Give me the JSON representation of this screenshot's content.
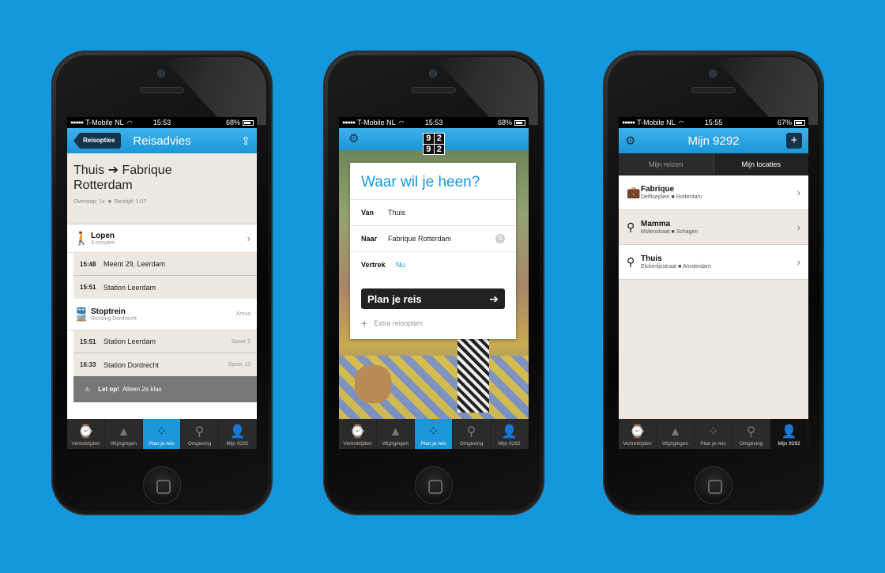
{
  "statusbar": {
    "carrier": "T-Mobile NL"
  },
  "tabs": [
    {
      "label": "Vertrektijden",
      "icon": "clock-icon"
    },
    {
      "label": "Wijzigingen",
      "icon": "cone-icon"
    },
    {
      "label": "Plan je reis",
      "icon": "route-icon"
    },
    {
      "label": "Omgeving",
      "icon": "pin-icon"
    },
    {
      "label": "Mijn 9292",
      "icon": "person-icon"
    }
  ],
  "screen1": {
    "time": "15:53",
    "battery": "68%",
    "back": "Reisopties",
    "title": "Reisadvies",
    "route_from": "Thuis",
    "route_to": "Fabrique",
    "route_to2": "Rotterdam",
    "overstap": "Overstap: 1x",
    "reistijd": "Reistijd: 1:07",
    "walk_title": "Lopen",
    "walk_sub": "3 minuten",
    "stop1_time": "15:48",
    "stop1_name": "Meent 29, Leerdam",
    "stop2_time": "15:51",
    "stop2_name": "Station Leerdam",
    "train_title": "Stoptrein",
    "train_sub": "Richting Dordrecht",
    "train_op": "Arriva",
    "stop3_time": "15:51",
    "stop3_name": "Station Leerdam",
    "stop3_platform": "Spoor 2",
    "stop4_time": "16:33",
    "stop4_name": "Station Dordrecht",
    "stop4_platform": "Spoor 15",
    "notice_bold": "Let op!",
    "notice_text": "Alleen 2e klas"
  },
  "screen2": {
    "time": "15:53",
    "battery": "68%",
    "logo": [
      "9",
      "2",
      "9",
      "2"
    ],
    "heading": "Waar wil je heen?",
    "van_label": "Van",
    "van_value": "Thuis",
    "naar_label": "Naar",
    "naar_value": "Fabrique Rotterdam",
    "vertrek_label": "Vertrek",
    "vertrek_value": "Nu",
    "plan_button": "Plan je reis",
    "extra": "Extra reisopties"
  },
  "screen3": {
    "time": "15:55",
    "battery": "67%",
    "title": "Mijn 9292",
    "seg_left": "Mijn reizen",
    "seg_right": "Mijn locaties",
    "locations": [
      {
        "name": "Fabrique",
        "street": "Delftseplein",
        "city": "Rotterdam"
      },
      {
        "name": "Mamma",
        "street": "Molenstraat",
        "city": "Schagen"
      },
      {
        "name": "Thuis",
        "street": "Elckerlijcstraat",
        "city": "Amsterdam"
      }
    ]
  },
  "colors": {
    "background": "#1597dd",
    "accent": "#1b97d9",
    "dark": "#15334a"
  }
}
